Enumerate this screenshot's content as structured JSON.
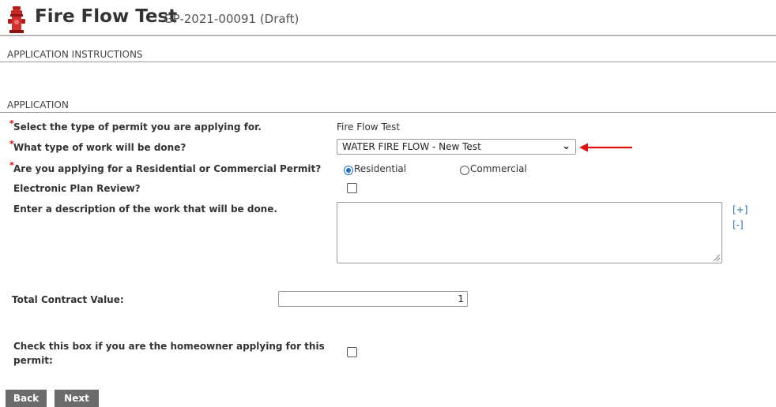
{
  "header": {
    "title": "Fire Flow Test",
    "subtitle": "GP-2021-00091 (Draft)",
    "icon": "fire-hydrant-icon"
  },
  "sections": {
    "instructions": "APPLICATION INSTRUCTIONS",
    "application": "APPLICATION"
  },
  "form": {
    "permit_type_label": "Select the type of permit you are applying for.",
    "permit_type_value": "Fire Flow Test",
    "work_type_label": "What type of work will be done?",
    "work_type_selected": "WATER FIRE FLOW - New Test",
    "permit_category_label": "Are you applying for a Residential or Commercial Permit?",
    "permit_category_options": [
      "Residential",
      "Commercial"
    ],
    "permit_category_selected": "Residential",
    "plan_review_label": "Electronic Plan Review?",
    "description_label": "Enter a description of the work that will be done.",
    "expand_label": "[+]",
    "collapse_label": "[-]",
    "contract_value_label": "Total Contract Value:",
    "contract_value": "1",
    "homeowner_label_line1": "Check this box if you are the homeowner applying for this",
    "homeowner_label_line2": "permit:",
    "required_marker": "*"
  },
  "buttons": {
    "back": "Back",
    "next": "Next"
  },
  "colors": {
    "required": "#dd0000",
    "button_bg": "#6b6b6b",
    "link": "#2a6eb5",
    "annotation_arrow": "#dd1111"
  }
}
